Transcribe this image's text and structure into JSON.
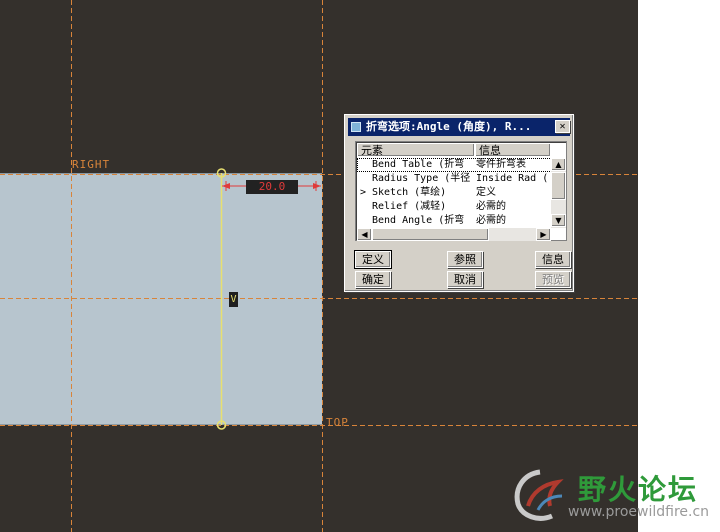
{
  "datums": {
    "right_label": "RIGHT",
    "top_label": "TOP"
  },
  "sketch": {
    "dimension_value": "20.0",
    "vertical_constraint": "V"
  },
  "dialog": {
    "title": "折弯选项:Angle (角度), R...",
    "columns": [
      "元素",
      "信息"
    ],
    "rows": [
      {
        "marker": "",
        "element": "Bend Table (折弯",
        "info": "零件折弯表"
      },
      {
        "marker": "",
        "element": "Radius Type (半径",
        "info": "Inside Rad ("
      },
      {
        "marker": ">",
        "element": "Sketch (草绘)",
        "info": "定义"
      },
      {
        "marker": "",
        "element": "Relief (减轻)",
        "info": "必需的"
      },
      {
        "marker": "",
        "element": "Bend Angle (折弯",
        "info": "必需的"
      }
    ],
    "buttons": {
      "define": "定义",
      "reference": "参照",
      "info": "信息",
      "ok": "确定",
      "cancel": "取消",
      "preview": "预览"
    }
  },
  "watermark": {
    "title": "野火论坛",
    "url": "www.proewildfire.cn"
  },
  "colors": {
    "canvas": "#34302c",
    "surface": "#b7c5ce",
    "datum": "#d8843a",
    "sketch": "#e8e070",
    "dimension": "#e03a3a"
  }
}
